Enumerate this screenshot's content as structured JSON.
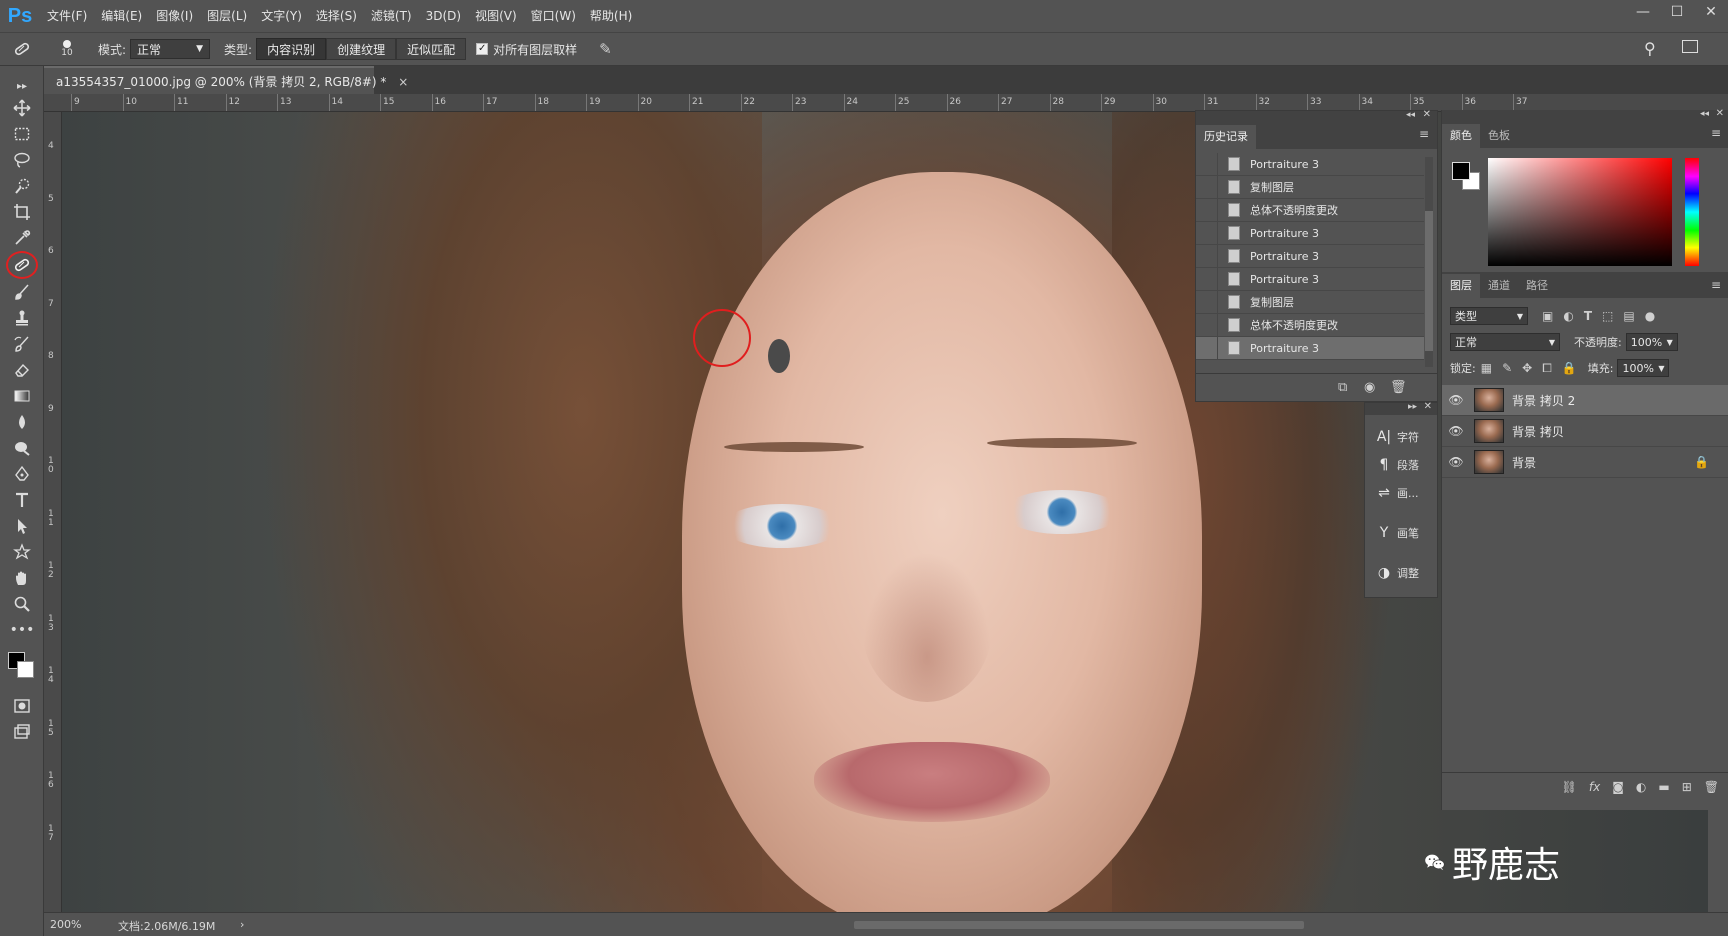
{
  "app": {
    "logo": "Ps",
    "menus": [
      "文件(F)",
      "编辑(E)",
      "图像(I)",
      "图层(L)",
      "文字(Y)",
      "选择(S)",
      "滤镜(T)",
      "3D(D)",
      "视图(V)",
      "窗口(W)",
      "帮助(H)"
    ],
    "window_controls": [
      "—",
      "☐",
      "✕"
    ]
  },
  "options": {
    "brush_size": "10",
    "mode_label": "模式:",
    "mode_value": "正常",
    "type_label": "类型:",
    "type_buttons": [
      "内容识别",
      "创建纹理",
      "近似匹配"
    ],
    "sample_all_label": "对所有图层取样"
  },
  "document": {
    "tab_title": "a13554357_01000.jpg @ 200% (背景 拷贝 2, RGB/8#) *",
    "close": "×"
  },
  "ruler": {
    "top_ticks": [
      "9",
      "10",
      "11",
      "12",
      "13",
      "14",
      "15",
      "16",
      "17",
      "18",
      "19",
      "20",
      "21",
      "22",
      "23",
      "24",
      "25",
      "26",
      "27",
      "28",
      "29",
      "30",
      "31",
      "32",
      "33",
      "34",
      "35",
      "36",
      "37"
    ],
    "left_ticks": [
      "4",
      "5",
      "6",
      "7",
      "8",
      "9",
      "1 0",
      "1 1",
      "1 2",
      "1 3",
      "1 4",
      "1 5",
      "1 6",
      "1 7"
    ]
  },
  "status": {
    "zoom": "200%",
    "doc_size": "文档:2.06M/6.19M",
    "arrow": "›"
  },
  "history": {
    "tab_label": "历史记录",
    "items": [
      "Portraiture 3",
      "复制图层",
      "总体不透明度更改",
      "Portraiture 3",
      "Portraiture 3",
      "Portraiture 3",
      "复制图层",
      "总体不透明度更改",
      "Portraiture 3"
    ]
  },
  "mini_panels": {
    "items": [
      {
        "label": "字符",
        "icon": "A|"
      },
      {
        "label": "段落",
        "icon": "¶"
      },
      {
        "label": "画...",
        "icon": "⇌"
      },
      {
        "label": "画笔",
        "icon": "Y"
      },
      {
        "label": "调整",
        "icon": "◑"
      }
    ]
  },
  "color_panel": {
    "tabs": [
      "颜色",
      "色板"
    ],
    "foreground": "#000000",
    "background": "#ffffff",
    "hue": "#ff0000"
  },
  "layers_panel": {
    "tabs": [
      "图层",
      "通道",
      "路径"
    ],
    "filter_value": "类型",
    "blend_mode": "正常",
    "opacity_label": "不透明度:",
    "opacity_value": "100%",
    "lock_label": "锁定:",
    "fill_label": "填充:",
    "fill_value": "100%",
    "layers": [
      {
        "name": "背景 拷贝 2",
        "selected": true,
        "locked": false
      },
      {
        "name": "背景 拷贝",
        "selected": false,
        "locked": false
      },
      {
        "name": "背景",
        "selected": false,
        "locked": true
      }
    ]
  },
  "watermark": {
    "text": "野鹿志"
  },
  "colors": {
    "ui_bg": "#535353",
    "panel_dark": "#424242",
    "highlight_circle": "#e01e1e",
    "ps_blue": "#31a8ff"
  }
}
